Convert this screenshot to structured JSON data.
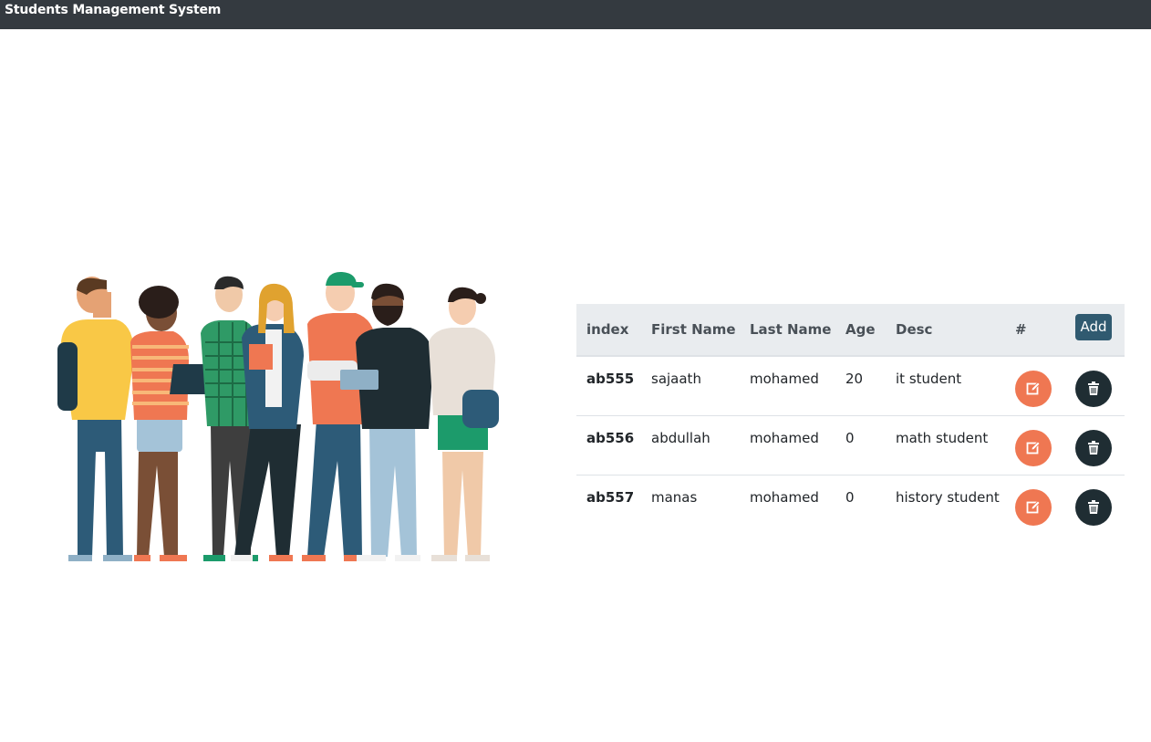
{
  "navbar": {
    "brand": "Students Management System"
  },
  "table": {
    "headers": {
      "index": "index",
      "first_name": "First Name",
      "last_name": "Last Name",
      "age": "Age",
      "desc": "Desc",
      "hash": "#",
      "add": "Add"
    },
    "rows": [
      {
        "index": "ab555",
        "first_name": "sajaath",
        "last_name": "mohamed",
        "age": "20",
        "desc": "it student"
      },
      {
        "index": "ab556",
        "first_name": "abdullah",
        "last_name": "mohamed",
        "age": "0",
        "desc": "math student"
      },
      {
        "index": "ab557",
        "first_name": "manas",
        "last_name": "mohamed",
        "age": "0",
        "desc": "history student"
      }
    ]
  },
  "icons": {
    "edit": "edit-icon",
    "delete": "trash-icon"
  },
  "colors": {
    "navbar": "#343a40",
    "edit_button": "#ef7752",
    "delete_button": "#1f2d33",
    "add_button": "#305a70",
    "table_header": "#e9ecef"
  }
}
